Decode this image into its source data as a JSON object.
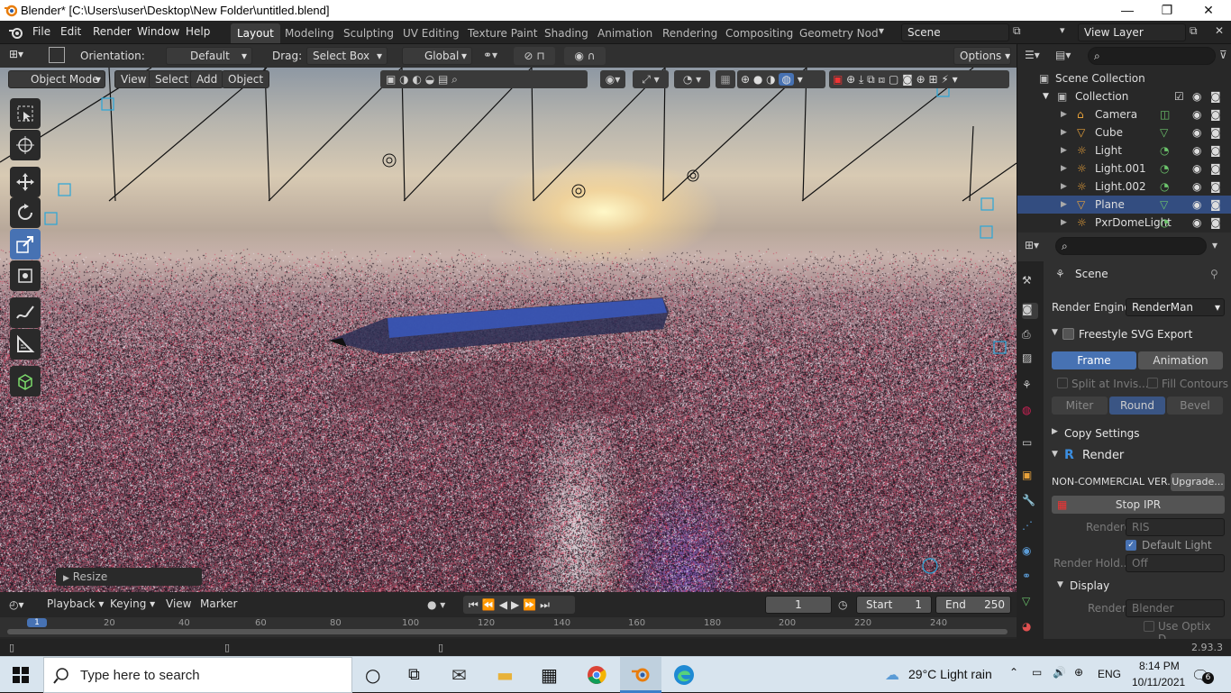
{
  "window": {
    "title": "Blender* [C:\\Users\\user\\Desktop\\New Folder\\untitled.blend]",
    "minimize": "—",
    "maximize": "❐",
    "close": "✕"
  },
  "menu": [
    "File",
    "Edit",
    "Render",
    "Window",
    "Help"
  ],
  "workspaces": [
    "Layout",
    "Modeling",
    "Sculpting",
    "UV Editing",
    "Texture Paint",
    "Shading",
    "Animation",
    "Rendering",
    "Compositing",
    "Geometry Nod"
  ],
  "scene": {
    "name": "Scene",
    "view_layer": "View Layer"
  },
  "tool_header": {
    "orientation_label": "Orientation:",
    "orientation_value": "Default",
    "drag_label": "Drag:",
    "drag_value": "Select Box",
    "transform_orientation": "Global",
    "options": "Options"
  },
  "viewport_header": {
    "mode": "Object Mode",
    "view": "View",
    "select": "Select",
    "add": "Add",
    "object": "Object"
  },
  "operator_panel": {
    "label": "Resize"
  },
  "timeline": {
    "playback": "Playback",
    "keying": "Keying",
    "view": "View",
    "marker": "Marker",
    "current_frame": "1",
    "start_label": "Start",
    "start": "1",
    "end_label": "End",
    "end": "250",
    "ticks": [
      "1",
      "20",
      "40",
      "60",
      "80",
      "100",
      "120",
      "140",
      "160",
      "180",
      "200",
      "220",
      "240"
    ]
  },
  "outliner": {
    "root": "Scene Collection",
    "collection": "Collection",
    "items": [
      {
        "name": "Camera",
        "icon": "camera-icon"
      },
      {
        "name": "Cube",
        "icon": "mesh-icon"
      },
      {
        "name": "Light",
        "icon": "light-icon"
      },
      {
        "name": "Light.001",
        "icon": "light-icon"
      },
      {
        "name": "Light.002",
        "icon": "light-icon"
      },
      {
        "name": "Plane",
        "icon": "mesh-icon",
        "selected": true
      },
      {
        "name": "PxrDomeLight",
        "icon": "light-icon"
      }
    ]
  },
  "properties": {
    "context": "Scene",
    "render_engine_label": "Render Engine",
    "render_engine": "RenderMan",
    "freestyle": "Freestyle SVG Export",
    "frame_btn": "Frame",
    "animation_btn": "Animation",
    "split_invis": "Split at Invis...",
    "fill_contours": "Fill Contours",
    "miter": "Miter",
    "round": "Round",
    "bevel": "Bevel",
    "copy_settings": "Copy Settings",
    "render_panel": "Render",
    "noncommercial": "NON-COMMERCIAL VER...",
    "upgrade": "Upgrade...",
    "stop_ipr": "Stop IPR",
    "renderer_label": "Renderer",
    "renderer_value": "RIS",
    "default_light": "Default Light",
    "render_hold_label": "Render Hold...",
    "render_hold_value": "Off",
    "display": "Display",
    "render_to_label": "Render to",
    "render_to_value": "Blender",
    "use_optix": "Use Optix D..."
  },
  "status": {
    "version": "2.93.3"
  },
  "taskbar": {
    "search_placeholder": "Type here to search",
    "weather": "29°C  Light rain",
    "lang": "ENG",
    "time": "8:14 PM",
    "date": "10/11/2021",
    "notifications": "6"
  },
  "colors": {
    "accent": "#4772b3",
    "selection": "#334d80",
    "header": "#303030"
  }
}
